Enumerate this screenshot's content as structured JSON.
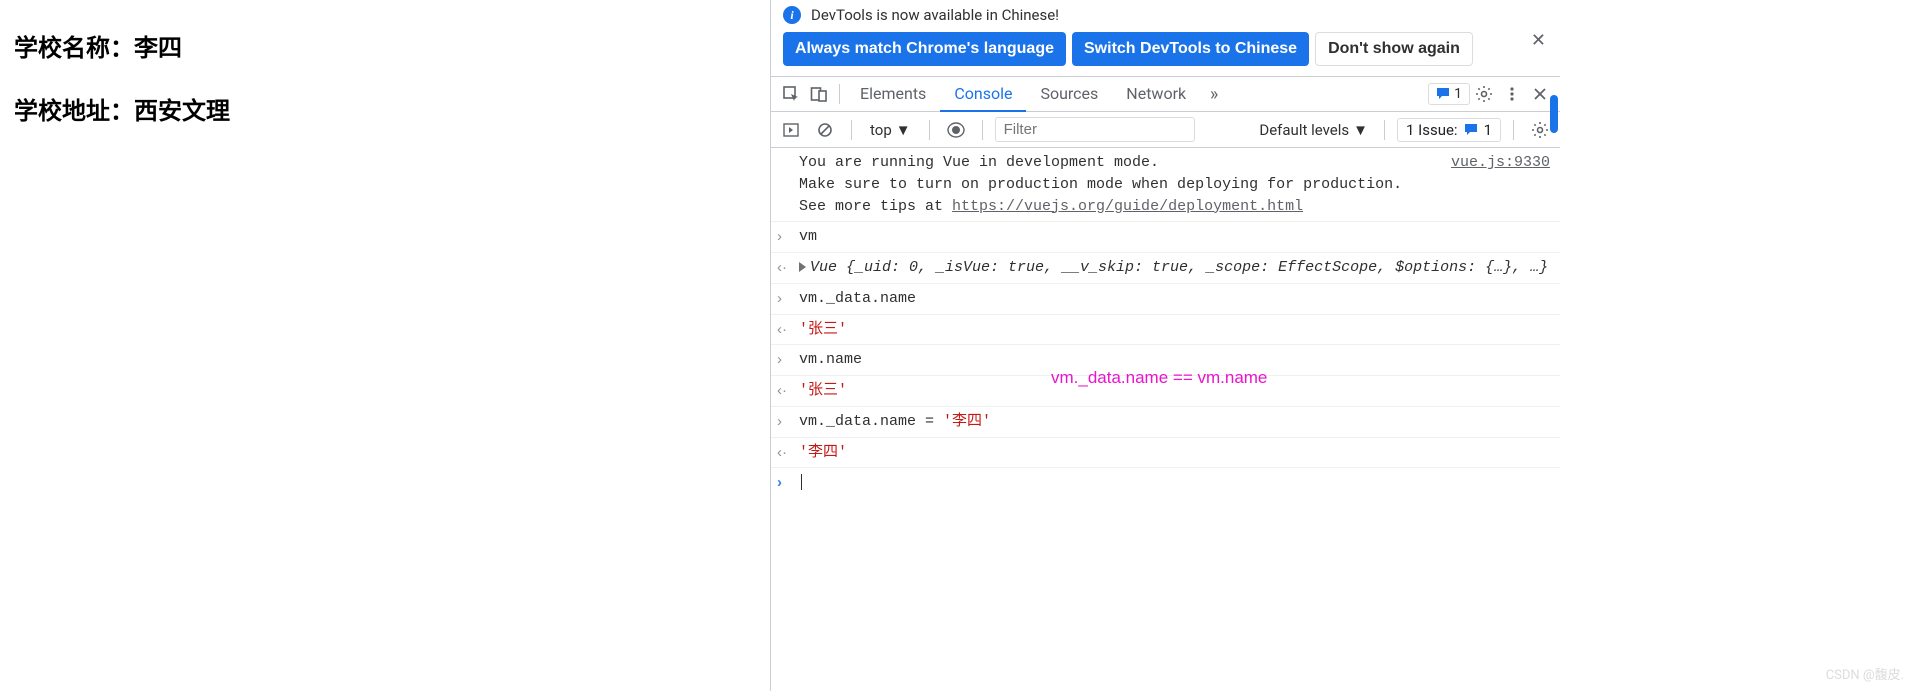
{
  "page": {
    "line1_label": "学校名称：",
    "line1_value": "李四",
    "line2_label": "学校地址：",
    "line2_value": "西安文理"
  },
  "infobar": {
    "text": "DevTools is now available in Chinese!",
    "btn_match": "Always match Chrome's language",
    "btn_switch": "Switch DevTools to Chinese",
    "btn_dismiss": "Don't show again"
  },
  "tabs": {
    "elements": "Elements",
    "console": "Console",
    "sources": "Sources",
    "network": "Network",
    "issues_count": "1"
  },
  "console_toolbar": {
    "context": "top",
    "filter_placeholder": "Filter",
    "levels": "Default levels",
    "issue_label": "1 Issue:",
    "issue_count": "1"
  },
  "logs": {
    "vue_warn_l1": "You are running Vue in development mode.",
    "vue_warn_l2": "Make sure to turn on production mode when deploying for production.",
    "vue_warn_l3_prefix": "See more tips at ",
    "vue_warn_l3_link": "https://vuejs.org/guide/deployment.html",
    "vue_warn_source": "vue.js:9330",
    "in1": "vm",
    "out1": "Vue {_uid: 0, _isVue: true, __v_skip: true, _scope: EffectScope, $options: {…}, …}",
    "in2": "vm._data.name",
    "out2": "'张三'",
    "in3": "vm.name",
    "out3": "'张三'",
    "in4_code": "vm._data.name = ",
    "in4_str": "'李四'",
    "out4": "'李四'"
  },
  "annotation": "vm._data.name == vm.name",
  "watermark": "CSDN @馥皮."
}
